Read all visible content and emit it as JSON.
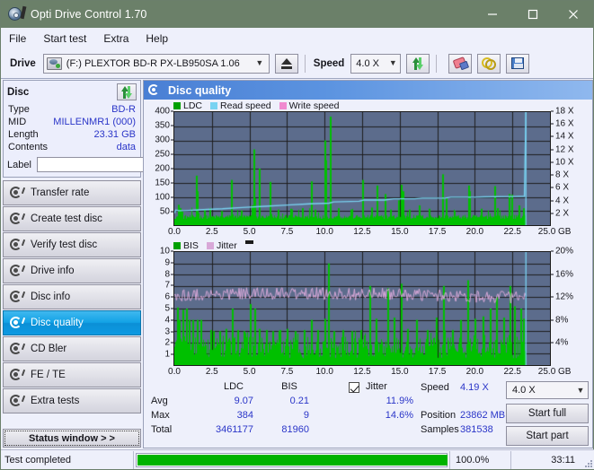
{
  "window": {
    "title": "Opti Drive Control 1.70",
    "icon": "disc-pen-icon",
    "minimize": "—",
    "maximize": "□",
    "close": "✕"
  },
  "menu": {
    "items": [
      {
        "label": "File"
      },
      {
        "label": "Start test"
      },
      {
        "label": "Extra"
      },
      {
        "label": "Help"
      }
    ]
  },
  "toolbar": {
    "drive_label": "Drive",
    "drive_value": "(F:)   PLEXTOR BD-R  PX-LB950SA 1.06",
    "eject_icon": "eject-icon",
    "speed_label": "Speed",
    "speed_value": "4.0 X",
    "refresh_icon": "refresh-icon",
    "eraser_icon": "eraser-icon",
    "chain_icon": "chain-icon",
    "save_icon": "floppy-save-icon"
  },
  "sidebar": {
    "disc_panel": {
      "title": "Disc",
      "refresh_icon": "refresh-icon",
      "rows": [
        {
          "key": "Type",
          "value": "BD-R"
        },
        {
          "key": "MID",
          "value": "MILLENMR1 (000)"
        },
        {
          "key": "Length",
          "value": "23.31 GB"
        },
        {
          "key": "Contents",
          "value": "data"
        }
      ],
      "label_key": "Label",
      "label_value": "",
      "label_placeholder": "",
      "label_button_icon": "cd-icon"
    },
    "items": [
      {
        "label": "Transfer rate",
        "icon": "disc-test-icon",
        "active": false
      },
      {
        "label": "Create test disc",
        "icon": "disc-test-icon",
        "active": false
      },
      {
        "label": "Verify test disc",
        "icon": "disc-test-icon",
        "active": false
      },
      {
        "label": "Drive info",
        "icon": "disc-test-icon",
        "active": false
      },
      {
        "label": "Disc info",
        "icon": "disc-test-icon",
        "active": false
      },
      {
        "label": "Disc quality",
        "icon": "disc-test-icon",
        "active": true
      },
      {
        "label": "CD Bler",
        "icon": "disc-test-icon",
        "active": false
      },
      {
        "label": "FE / TE",
        "icon": "disc-test-icon",
        "active": false
      },
      {
        "label": "Extra tests",
        "icon": "disc-test-icon",
        "active": false
      }
    ],
    "status_window_button": "Status window > >"
  },
  "main": {
    "header_title": "Disc quality",
    "header_icon": "disc-quality-icon"
  },
  "stats": {
    "col_ldc": "LDC",
    "col_bis": "BIS",
    "row_avg": "Avg",
    "row_max": "Max",
    "row_total": "Total",
    "ldc_avg": "9.07",
    "ldc_max": "384",
    "ldc_total": "3461177",
    "bis_avg": "0.21",
    "bis_max": "9",
    "bis_total": "81960",
    "jitter_label": "Jitter",
    "jitter_checked": true,
    "jitter_avg": "11.9%",
    "jitter_max": "14.6%",
    "speed_key": "Speed",
    "speed_value": "4.19 X",
    "position_key": "Position",
    "position_value": "23862 MB",
    "samples_key": "Samples",
    "samples_value": "381538",
    "speed_combo": "4.0 X",
    "start_full": "Start full",
    "start_part": "Start part"
  },
  "statusbar": {
    "text": "Test completed",
    "percent_label": "100.0%",
    "percent_value": 100,
    "elapsed": "33:11"
  },
  "colors": {
    "accent": "#0b8fd6",
    "plot_bg": "#5c6c8c",
    "ldc_green": "#00c000",
    "read_speed": "#79d3f2",
    "write_speed": "#f08ad0",
    "jitter_pink": "#d8a8d8",
    "value_blue": "#2a35c8",
    "progress_green": "#00b300",
    "titlebar": "#6b8069"
  },
  "chart_data": [
    {
      "type": "line",
      "title": "Disc quality - LDC / Read speed",
      "xlabel": "GB",
      "ylabel": "LDC",
      "xlim": [
        0,
        25
      ],
      "ylim": [
        0,
        400
      ],
      "y2lim": [
        0,
        18
      ],
      "y2label": "X",
      "grid": true,
      "legend": [
        "LDC",
        "Read speed",
        "Write speed"
      ],
      "legend_position": "top-left",
      "xticks": [
        "0.0",
        "2.5",
        "5.0",
        "7.5",
        "10.0",
        "12.5",
        "15.0",
        "17.5",
        "20.0",
        "22.5",
        "25.0"
      ],
      "yticks": [
        50,
        100,
        150,
        200,
        250,
        300,
        350,
        400
      ],
      "y2ticks": [
        "2 X",
        "4 X",
        "6 X",
        "8 X",
        "10 X",
        "12 X",
        "14 X",
        "16 X",
        "18 X"
      ],
      "data_end_gb": 23.4,
      "series": [
        {
          "name": "LDC",
          "color": "#00c000",
          "baseline": 22,
          "spikes": [
            [
              0.25,
              72
            ],
            [
              0.35,
              60
            ],
            [
              0.5,
              48
            ],
            [
              1.45,
              175
            ],
            [
              1.5,
              120
            ],
            [
              2.0,
              55
            ],
            [
              2.35,
              60
            ],
            [
              3.1,
              50
            ],
            [
              3.75,
              160
            ],
            [
              4.4,
              52
            ],
            [
              5.15,
              70
            ],
            [
              5.25,
              268
            ],
            [
              5.35,
              95
            ],
            [
              5.6,
              200
            ],
            [
              6.35,
              153
            ],
            [
              6.9,
              55
            ],
            [
              7.7,
              58
            ],
            [
              8.5,
              60
            ],
            [
              9.1,
              155
            ],
            [
              9.35,
              55
            ],
            [
              10.0,
              300
            ],
            [
              10.05,
              230
            ],
            [
              10.35,
              384
            ],
            [
              10.9,
              60
            ],
            [
              11.7,
              55
            ],
            [
              12.5,
              160
            ],
            [
              13.1,
              62
            ],
            [
              13.45,
              140
            ],
            [
              14.0,
              110
            ],
            [
              14.35,
              55
            ],
            [
              14.9,
              88
            ],
            [
              15.1,
              143
            ],
            [
              15.2,
              120
            ],
            [
              15.6,
              55
            ],
            [
              16.25,
              70
            ],
            [
              16.9,
              58
            ],
            [
              17.85,
              180
            ],
            [
              18.05,
              95
            ],
            [
              19.55,
              140
            ],
            [
              19.6,
              120
            ],
            [
              20.4,
              58
            ],
            [
              21.3,
              138
            ],
            [
              21.45,
              60
            ],
            [
              22.25,
              110
            ],
            [
              22.45,
              108
            ],
            [
              22.9,
              70
            ],
            [
              23.2,
              60
            ]
          ]
        },
        {
          "name": "Read speed",
          "color": "#79d3f2",
          "points": [
            [
              0.0,
              1.9
            ],
            [
              0.1,
              2.4
            ],
            [
              0.3,
              2.3
            ],
            [
              0.7,
              2.3
            ],
            [
              1.4,
              2.4
            ],
            [
              2.2,
              2.5
            ],
            [
              3.2,
              2.6
            ],
            [
              4.5,
              2.8
            ],
            [
              6.0,
              3.0
            ],
            [
              7.5,
              3.2
            ],
            [
              9.0,
              3.4
            ],
            [
              10.3,
              3.5
            ],
            [
              10.6,
              3.7
            ],
            [
              12.3,
              3.8
            ],
            [
              12.6,
              4.0
            ],
            [
              14.0,
              4.0
            ],
            [
              14.6,
              4.2
            ],
            [
              16.0,
              4.2
            ],
            [
              16.5,
              4.3
            ],
            [
              18.0,
              4.3
            ],
            [
              18.4,
              4.45
            ],
            [
              20.0,
              4.45
            ],
            [
              20.6,
              4.5
            ],
            [
              22.5,
              4.55
            ],
            [
              23.3,
              4.6
            ],
            [
              23.4,
              18.0
            ]
          ]
        },
        {
          "name": "Write speed",
          "color": "#f08ad0",
          "points": []
        }
      ]
    },
    {
      "type": "line",
      "title": "Disc quality - BIS / Jitter",
      "xlabel": "GB",
      "ylabel": "BIS",
      "xlim": [
        0,
        25
      ],
      "ylim": [
        0,
        10
      ],
      "y2lim": [
        0,
        20
      ],
      "y2label": "%",
      "grid": true,
      "legend": [
        "BIS",
        "Jitter",
        ""
      ],
      "legend_position": "top-left",
      "xticks": [
        "0.0",
        "2.5",
        "5.0",
        "7.5",
        "10.0",
        "12.5",
        "15.0",
        "17.5",
        "20.0",
        "22.5",
        "25.0"
      ],
      "yticks": [
        1,
        2,
        3,
        4,
        5,
        6,
        7,
        8,
        9,
        10
      ],
      "y2ticks": [
        "4%",
        "8%",
        "12%",
        "16%",
        "20%"
      ],
      "data_end_gb": 23.4,
      "series": [
        {
          "name": "BIS",
          "color": "#00c000",
          "baseline": 1.6,
          "spikes": [
            [
              0.15,
              5.1
            ],
            [
              0.3,
              4.0
            ],
            [
              0.55,
              4.9
            ],
            [
              0.75,
              5.0
            ],
            [
              0.95,
              4.0
            ],
            [
              1.2,
              4.0
            ],
            [
              1.5,
              4.0
            ],
            [
              1.75,
              4.0
            ],
            [
              2.4,
              3.1
            ],
            [
              2.6,
              3.0
            ],
            [
              3.0,
              3.0
            ],
            [
              3.4,
              3.2
            ],
            [
              3.8,
              5.0
            ],
            [
              4.2,
              3.1
            ],
            [
              4.6,
              3.0
            ],
            [
              5.0,
              5.4
            ],
            [
              5.3,
              5.0
            ],
            [
              5.6,
              3.2
            ],
            [
              6.1,
              3.1
            ],
            [
              6.5,
              3.0
            ],
            [
              7.0,
              3.1
            ],
            [
              7.5,
              3.2
            ],
            [
              8.0,
              3.0
            ],
            [
              8.6,
              3.1
            ],
            [
              9.1,
              4.0
            ],
            [
              9.5,
              3.1
            ],
            [
              10.0,
              4.1
            ],
            [
              10.25,
              9.0
            ],
            [
              10.6,
              3.0
            ],
            [
              11.2,
              3.1
            ],
            [
              11.8,
              3.0
            ],
            [
              12.4,
              3.1
            ],
            [
              13.0,
              7.0
            ],
            [
              13.4,
              4.1
            ],
            [
              14.2,
              6.8
            ],
            [
              14.6,
              4.2
            ],
            [
              15.1,
              7.2
            ],
            [
              15.5,
              3.2
            ],
            [
              16.1,
              4.0
            ],
            [
              16.8,
              3.1
            ],
            [
              17.4,
              4.2
            ],
            [
              17.9,
              7.0
            ],
            [
              18.5,
              3.1
            ],
            [
              19.0,
              4.0
            ],
            [
              19.5,
              7.5
            ],
            [
              20.0,
              4.1
            ],
            [
              20.5,
              4.3
            ],
            [
              21.0,
              5.0
            ],
            [
              21.4,
              6.0
            ],
            [
              21.9,
              4.2
            ],
            [
              22.3,
              7.0
            ],
            [
              22.6,
              5.2
            ],
            [
              23.0,
              5.0
            ],
            [
              23.2,
              4.1
            ]
          ]
        },
        {
          "name": "Jitter",
          "color": "#d8a8d8",
          "mean": 6.2,
          "amplitude": 0.55,
          "note": "noisy band around 11.9% (~6.2 on BIS scale)"
        }
      ]
    }
  ]
}
